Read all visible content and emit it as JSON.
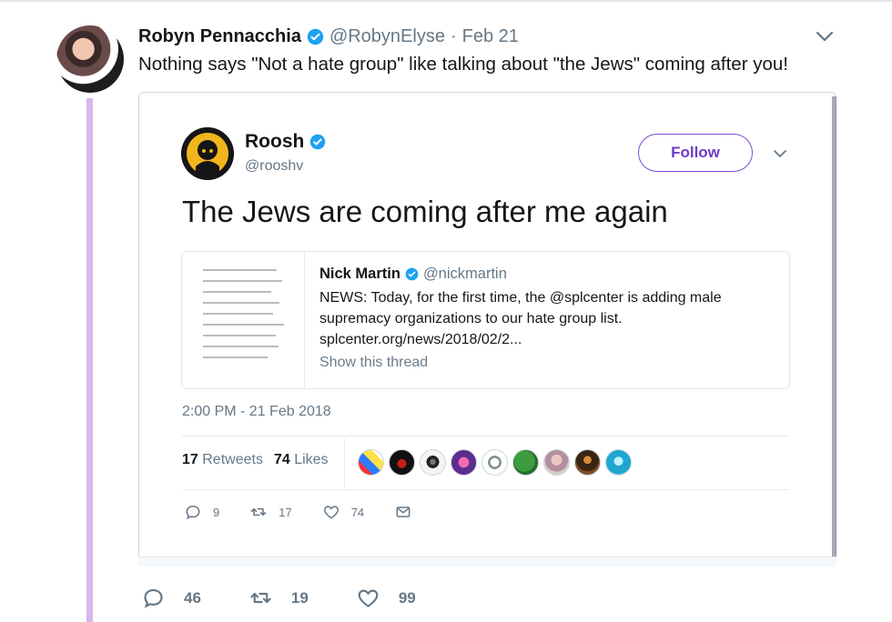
{
  "colors": {
    "verified": "#1da1f2",
    "purple": "#7f4ad3",
    "thread_line": "#d9b6ee",
    "muted": "#657786",
    "text": "#14171a"
  },
  "tweet": {
    "author": {
      "display_name": "Robyn Pennacchia",
      "handle": "@RobynElyse",
      "dot": "·",
      "date": "Feb 21"
    },
    "text": "Nothing says \"Not a hate group\" like talking about \"the Jews\" coming after you!",
    "actions": {
      "replies": "46",
      "retweets": "19",
      "likes": "99"
    }
  },
  "embedded_tweet": {
    "author": {
      "display_name": "Roosh",
      "handle": "@rooshv"
    },
    "follow_label": "Follow",
    "text": "The Jews are coming after me again",
    "quoted": {
      "display_name": "Nick Martin",
      "handle": "@nickmartin",
      "text": "NEWS: Today, for the first time, the @splcenter is adding male supremacy organizations to our hate group list. splcenter.org/news/2018/02/2...",
      "show_thread": "Show this thread"
    },
    "timestamp": "2:00 PM - 21 Feb 2018",
    "stats": {
      "retweets_count": "17",
      "retweets_label": "Retweets",
      "likes_count": "74",
      "likes_label": "Likes"
    },
    "actions": {
      "replies": "9",
      "retweets": "17",
      "likes": "74"
    },
    "liker_avatar_icons": [
      "warning-avatar-icon",
      "dark-avatar-icon",
      "pot-avatar-icon",
      "purple-avatar-icon",
      "logo-avatar-icon",
      "pepe-avatar-icon",
      "portrait-avatar-icon",
      "person-avatar-icon",
      "blue-avatar-icon"
    ]
  }
}
